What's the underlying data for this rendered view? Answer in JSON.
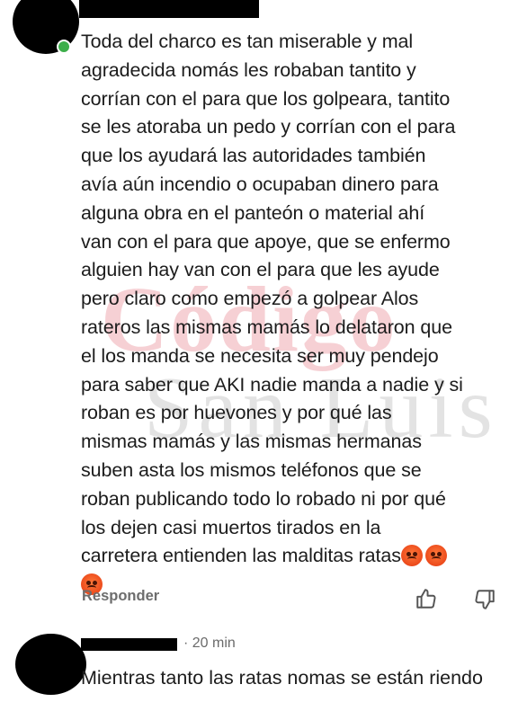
{
  "comment1": {
    "lines": [
      "Toda del charco es tan miserable y mal",
      "agradecida nomás les robaban tantito y",
      "corrían con el para que los golpeara, tantito",
      "se les atoraba un pedo y corrían con el para",
      "que los ayudará las autoridades también",
      "avía aún incendio o ocupaban dinero para",
      "alguna obra en el panteón o material ahí",
      "van con el para que apoye, que se enfermo",
      "alguien hay van con el para que les ayude",
      "pero claro como empezó a golpear Alos",
      "rateros las mismas mamás lo delataron que",
      "el los manda se necesita ser muy pendejo",
      "para saber que AKI nadie manda a nadie y si",
      "roban es por huevones y por qué las",
      "mismas mamás y las mismas hermanas",
      "suben asta los mismos teléfonos que se",
      "roban publicando todo lo robado ni por qué",
      "los dejen casi muertos tirados en la",
      "carretera  entienden las malditas ratas"
    ],
    "emoji_icon": "angry-face",
    "reply_label": "Responder"
  },
  "watermark": {
    "line1": "Código",
    "line2": "San Luis"
  },
  "comment2": {
    "time": "· 20 min",
    "text": "Mientras tanto las ratas nomas se están riendo"
  },
  "colors": {
    "online": "#3cae4a",
    "emoji": "#ec4a1c",
    "watermark_red": "#d5283c"
  }
}
